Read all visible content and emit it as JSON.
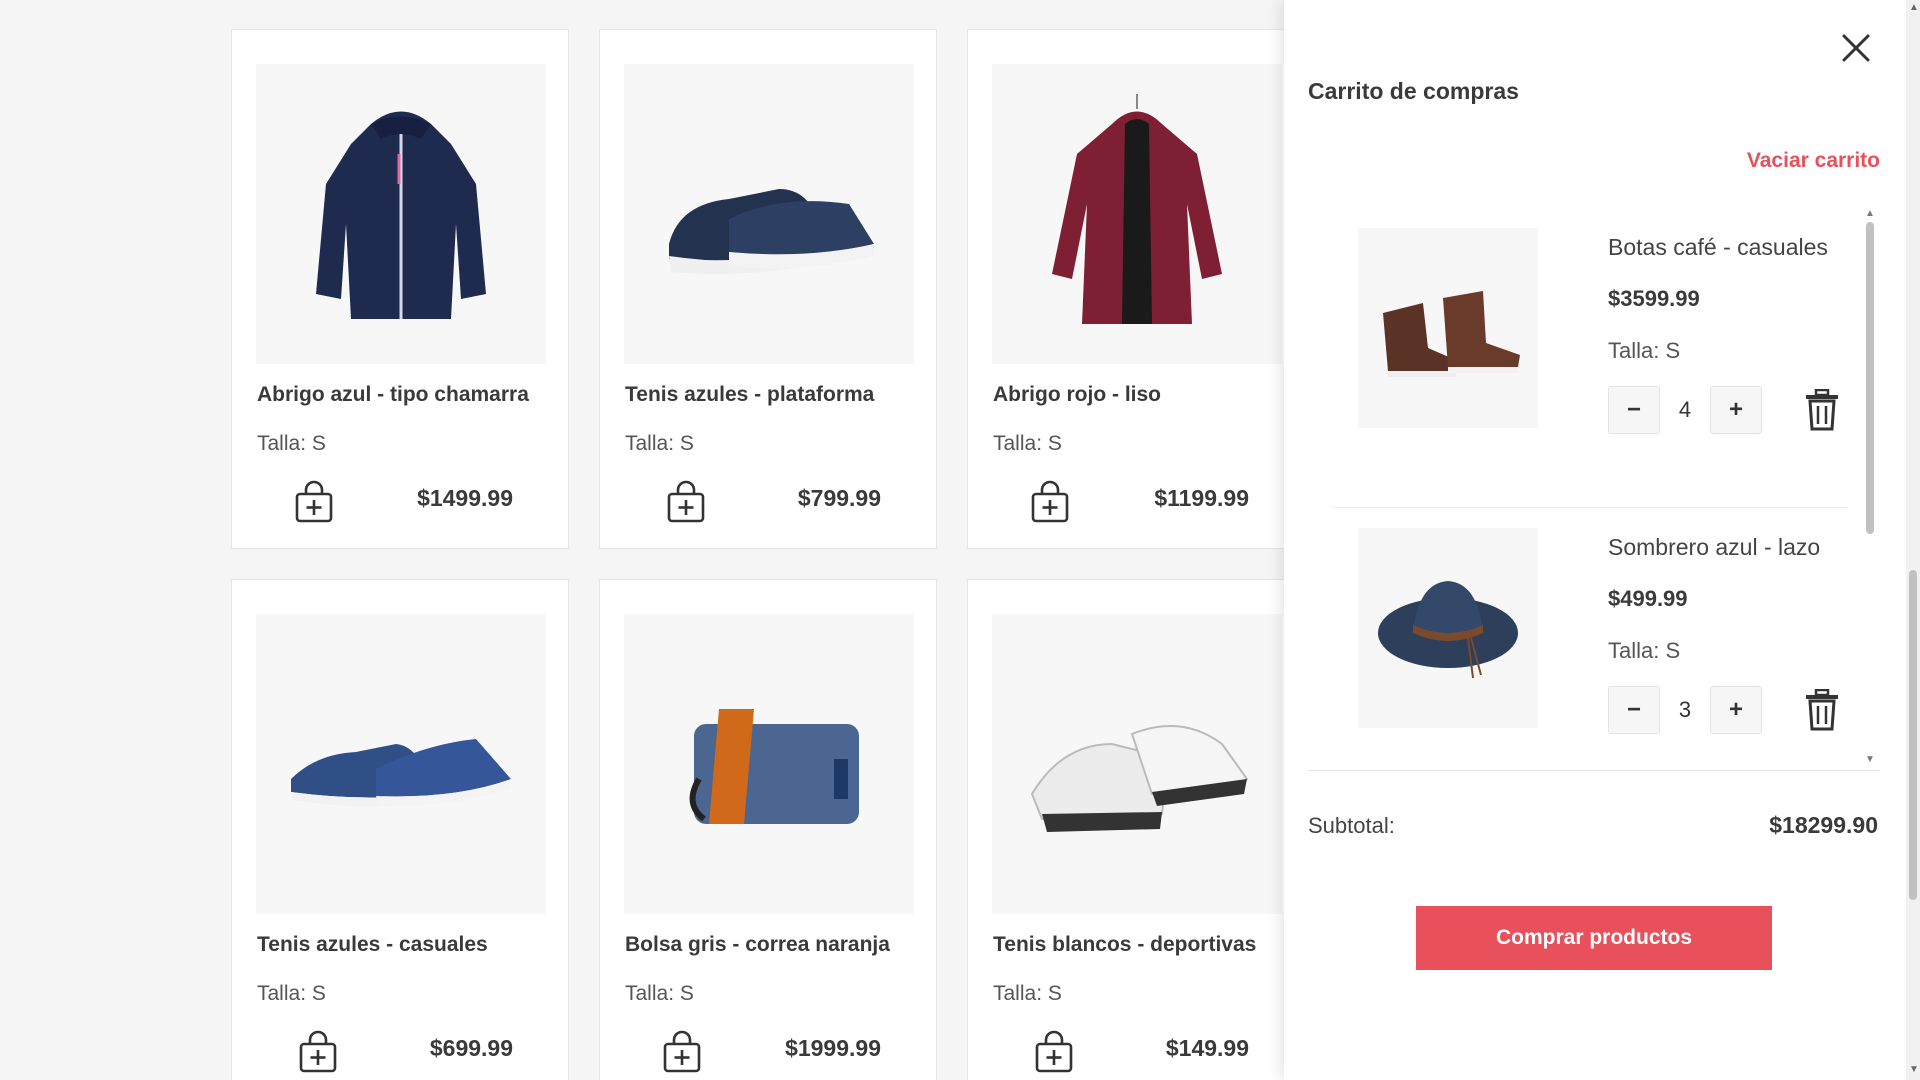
{
  "products": [
    {
      "name": "Abrigo azul - tipo chamarra",
      "size": "Talla: S",
      "price": "$1499.99",
      "image": "blue-puffer-jacket",
      "color": "#1f2a4f"
    },
    {
      "name": "Tenis azules - plataforma",
      "size": "Talla: S",
      "price": "$799.99",
      "image": "blue-platform-sneakers",
      "color": "#2a3a5c"
    },
    {
      "name": "Abrigo rojo - liso",
      "size": "Talla: S",
      "price": "$1199.99",
      "image": "red-hooded-coat",
      "color": "#7e1f33"
    },
    {
      "name": "Tenis azules - casuales",
      "size": "Talla: S",
      "price": "$699.99",
      "image": "blue-casual-sneakers",
      "color": "#2f4f86"
    },
    {
      "name": "Bolsa gris - correa naranja",
      "size": "Talla: S",
      "price": "$1999.99",
      "image": "gray-bag-orange-strap",
      "color": "#4b6791"
    },
    {
      "name": "Tenis blancos - deportivas",
      "size": "Talla: S",
      "price": "$149.99",
      "image": "white-sport-sneakers",
      "color": "#e8e8e8"
    }
  ],
  "cart": {
    "title": "Carrito de compras",
    "empty_label": "Vaciar carrito",
    "items": [
      {
        "name": "Botas café - casuales",
        "price": "$3599.99",
        "size": "Talla: S",
        "quantity": "4",
        "image": "brown-boots",
        "color": "#5a3326"
      },
      {
        "name": "Sombrero azul - lazo",
        "price": "$499.99",
        "size": "Talla: S",
        "quantity": "3",
        "image": "blue-hat",
        "color": "#2d3f5a"
      }
    ],
    "decrement_label": "−",
    "increment_label": "+",
    "subtotal_label": "Subtotal:",
    "subtotal_value": "$18299.90",
    "buy_label": "Comprar productos"
  },
  "colors": {
    "accent": "#e8505b"
  }
}
